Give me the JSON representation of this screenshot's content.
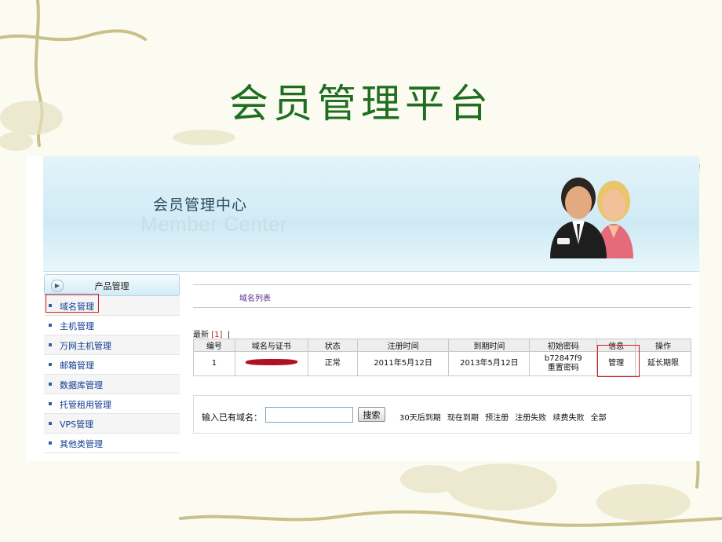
{
  "slide": {
    "title": "会员管理平台"
  },
  "banner": {
    "title": "会员管理中心",
    "subtitle": "Member Center"
  },
  "sidebar": {
    "header": "产品管理",
    "items": [
      {
        "label": "域名管理"
      },
      {
        "label": "主机管理"
      },
      {
        "label": "万网主机管理"
      },
      {
        "label": "邮箱管理"
      },
      {
        "label": "数据库管理"
      },
      {
        "label": "托管租用管理"
      },
      {
        "label": "VPS管理"
      },
      {
        "label": "其他类管理"
      }
    ]
  },
  "main": {
    "tab": "域名列表",
    "pager": {
      "latest": "最新",
      "page": "[1]",
      "sep": "|"
    },
    "table": {
      "headers": [
        "编号",
        "域名与证书",
        "状态",
        "注册时间",
        "到期时间",
        "初始密码",
        "信息",
        "操作"
      ],
      "rows": [
        {
          "id": "1",
          "status": "正常",
          "registered": "2011年5月12日",
          "expires": "2013年5月12日",
          "password": "b72847f9",
          "reset": "重置密码",
          "info": "管理",
          "action": "延长期限"
        }
      ]
    },
    "search": {
      "label": "输入已有域名：",
      "value": "",
      "button": "搜索",
      "filters": [
        "30天后到期",
        "现在到期",
        "预注册",
        "注册失败",
        "续费失败",
        "全部"
      ]
    }
  },
  "colors": {
    "title_green": "#1f6e1f",
    "highlight_red": "#d61e1e",
    "link_blue": "#0f3c8f"
  }
}
